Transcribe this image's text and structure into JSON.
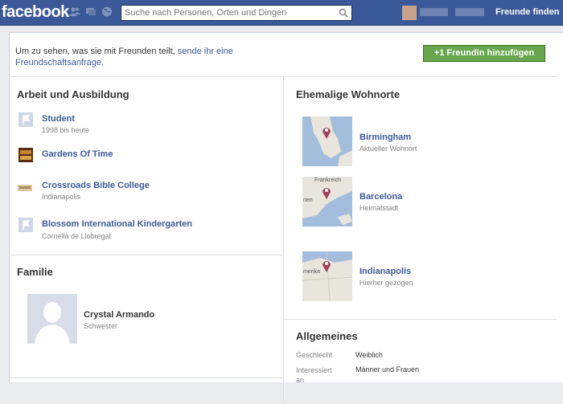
{
  "topbar": {
    "logo": "facebook",
    "search_placeholder": "Suche nach Personen, Orten und Dingen",
    "friends_link": "Freunde finden"
  },
  "notice": {
    "text": "Um zu sehen, was sie mit Freunden teilt, ",
    "link": "sende ihr eine Freundschaftsanfrage."
  },
  "add_friend_button": "+1 Freundin hinzufügen",
  "work": {
    "heading": "Arbeit und Ausbildung",
    "items": [
      {
        "title": "Student",
        "sub": "1998 bis heute",
        "icon": "flag-icon"
      },
      {
        "title": "Gardens Of Time",
        "sub": "",
        "icon": "game-icon"
      },
      {
        "title": "Crossroads Bible College",
        "sub": "Indianapolis",
        "icon": "college-icon"
      },
      {
        "title": "Blossom International Kindergarten",
        "sub": "Cornellà de Llobregat",
        "icon": "flag-icon"
      }
    ]
  },
  "family": {
    "heading": "Familie",
    "member": {
      "name": "Crystal Armando",
      "relation": "Schwester"
    }
  },
  "places": {
    "heading": "Ehemalige Wohnorte",
    "items": [
      {
        "city": "Birmingham",
        "note": "Aktueller Wohnort"
      },
      {
        "city": "Barcelona",
        "note": "Heimatstadt",
        "map_label_top": "Frankreich",
        "map_label_left": "rien"
      },
      {
        "city": "Indianapolis",
        "note": "Hierher gezogen",
        "map_label_left": "merika"
      }
    ]
  },
  "general": {
    "heading": "Allgemeines",
    "rows": [
      {
        "label": "Geschlecht",
        "value": "Weiblich"
      },
      {
        "label": "Interessiert an",
        "value": "Männer und Frauen"
      }
    ]
  },
  "colors": {
    "fb_blue": "#3b5998",
    "button_green": "#69a74e"
  }
}
